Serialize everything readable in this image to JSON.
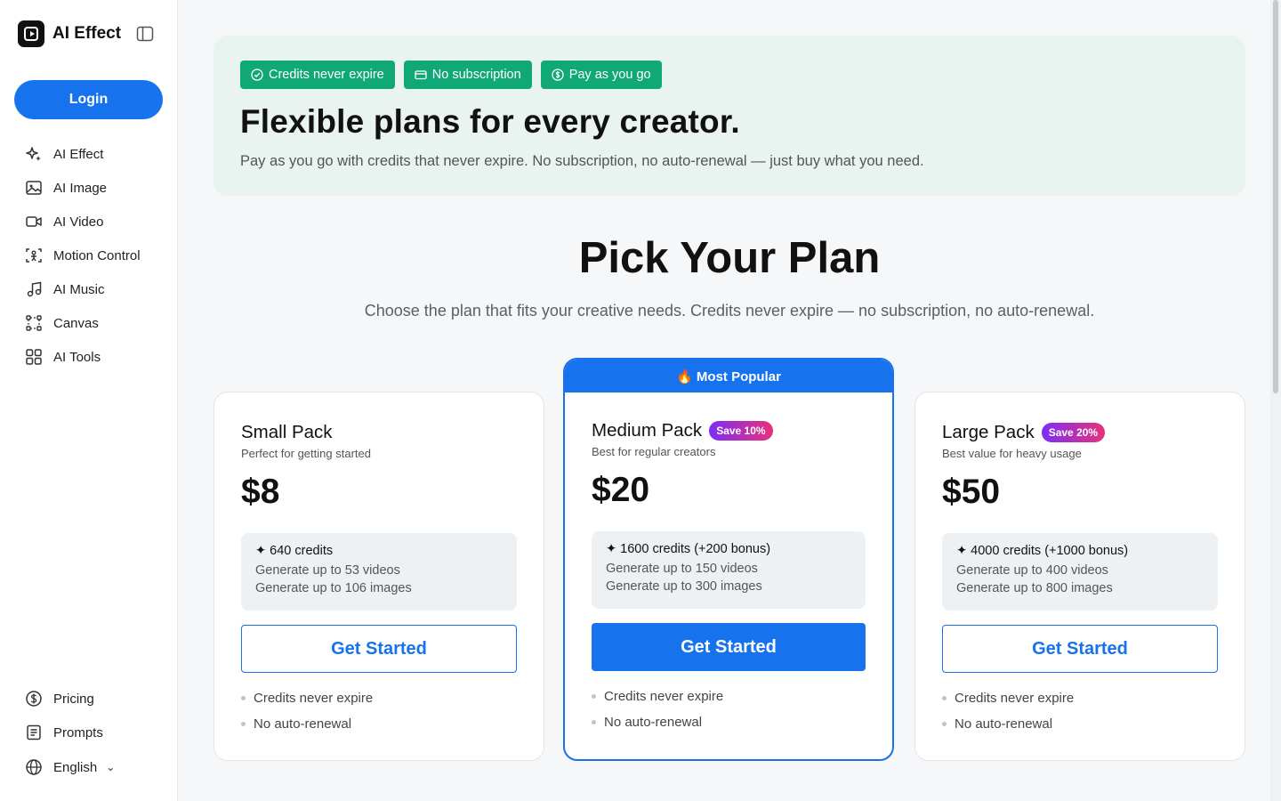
{
  "brand": {
    "name": "AI Effect",
    "logo_icon": "logo-icon"
  },
  "sidebar": {
    "login_label": "Login",
    "items": [
      {
        "label": "AI Effect",
        "icon": "sparkles-icon"
      },
      {
        "label": "AI Image",
        "icon": "image-icon"
      },
      {
        "label": "AI Video",
        "icon": "video-icon"
      },
      {
        "label": "Motion Control",
        "icon": "motion-icon"
      },
      {
        "label": "AI Music",
        "icon": "music-icon"
      },
      {
        "label": "Canvas",
        "icon": "canvas-icon"
      },
      {
        "label": "AI Tools",
        "icon": "grid-icon"
      }
    ],
    "footer": {
      "pricing": "Pricing",
      "prompts": "Prompts",
      "language": "English"
    }
  },
  "hero": {
    "badges": [
      "Credits never expire",
      "No subscription",
      "Pay as you go"
    ],
    "title": "Flexible plans for every creator.",
    "subtitle": "Pay as you go with credits that never expire. No subscription, no auto-renewal — just buy what you need."
  },
  "plans_section": {
    "title": "Pick Your Plan",
    "subtitle": "Choose the plan that fits your creative needs. Credits never expire — no subscription, no auto-renewal."
  },
  "plans": [
    {
      "name": "Small Pack",
      "save": "",
      "description": "Perfect for getting started",
      "price": "$8",
      "credits": "✦ 640 credits",
      "videos": "Generate up to 53 videos",
      "images": "Generate up to 106 images",
      "cta": "Get Started",
      "bullets": [
        "Credits never expire",
        "No auto-renewal"
      ]
    },
    {
      "name": "Medium Pack",
      "save": "Save 10%",
      "description": "Best for regular creators",
      "ribbon": "🔥 Most Popular",
      "price": "$20",
      "credits": "✦ 1600 credits (+200 bonus)",
      "videos": "Generate up to 150 videos",
      "images": "Generate up to 300 images",
      "cta": "Get Started",
      "bullets": [
        "Credits never expire",
        "No auto-renewal"
      ]
    },
    {
      "name": "Large Pack",
      "save": "Save 20%",
      "description": "Best value for heavy usage",
      "price": "$50",
      "credits": "✦ 4000 credits (+1000 bonus)",
      "videos": "Generate up to 400 videos",
      "images": "Generate up to 800 images",
      "cta": "Get Started",
      "bullets": [
        "Credits never expire",
        "No auto-renewal"
      ]
    }
  ],
  "colors": {
    "primary": "#1672ed",
    "badge_green": "#10a876",
    "hero_bg": "#e9f3f0"
  }
}
